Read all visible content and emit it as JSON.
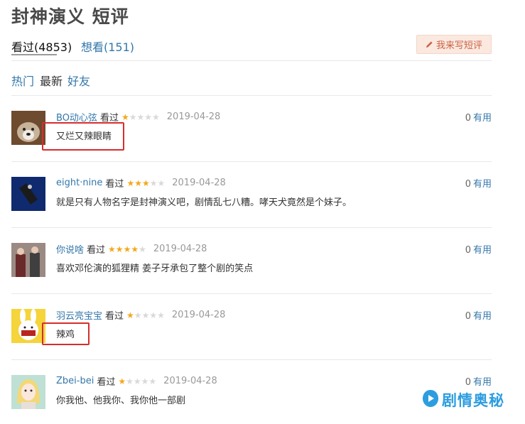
{
  "page": {
    "title": "封神演义 短评"
  },
  "tabs": [
    {
      "label": "看过(4853)",
      "active": true
    },
    {
      "label": "想看(151)",
      "active": false
    }
  ],
  "write_button": {
    "label": "我来写短评",
    "icon": "pencil-icon"
  },
  "filters": [
    "热门",
    "最新",
    "好友"
  ],
  "reviews": [
    {
      "user": "BO动心弦",
      "status": "看过",
      "stars": 1,
      "date": "2019-04-28",
      "text": "又烂又辣眼睛",
      "useful_count": "0",
      "useful_label": "有用",
      "highlighted": true
    },
    {
      "user": "eight·nine",
      "status": "看过",
      "stars": 3,
      "date": "2019-04-28",
      "text": "就是只有人物名字是封神演义吧，剧情乱七八糟。哮天犬竟然是个妹子。",
      "useful_count": "0",
      "useful_label": "有用",
      "highlighted": false
    },
    {
      "user": "你说啥",
      "status": "看过",
      "stars": 4,
      "date": "2019-04-28",
      "text": "喜欢邓伦演的狐狸精 姜子牙承包了整个剧的笑点",
      "useful_count": "0",
      "useful_label": "有用",
      "highlighted": false
    },
    {
      "user": "羽云亮宝宝",
      "status": "看过",
      "stars": 1,
      "date": "2019-04-28",
      "text": "辣鸡",
      "useful_count": "0",
      "useful_label": "有用",
      "highlighted": true
    },
    {
      "user": "Zbei-bei",
      "status": "看过",
      "stars": 1,
      "date": "2019-04-28",
      "text": "你我他、他我你、我你他一部剧",
      "useful_count": "0",
      "useful_label": "有用",
      "highlighted": false
    }
  ],
  "watermark": {
    "text": "剧情奥秘"
  },
  "colors": {
    "link": "#3377aa",
    "star": "#f4a81d",
    "highlight": "#d72d2d",
    "button_bg": "#fbe9e0",
    "watermark": "#2d9de0"
  }
}
